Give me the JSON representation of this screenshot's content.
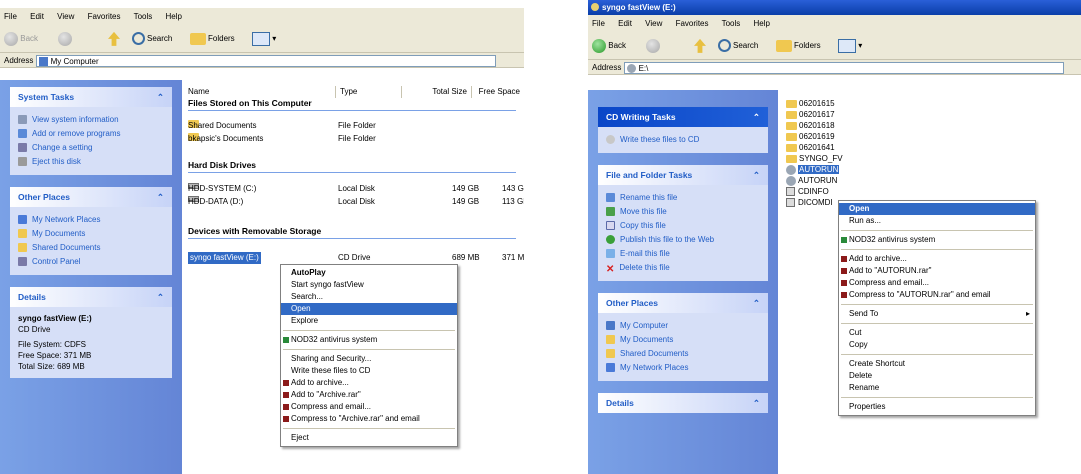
{
  "left": {
    "menu": [
      "File",
      "Edit",
      "View",
      "Favorites",
      "Tools",
      "Help"
    ],
    "toolbar": {
      "back": "Back",
      "search": "Search",
      "folders": "Folders"
    },
    "address": {
      "label": "Address",
      "value": "My Computer"
    },
    "system_tasks": {
      "title": "System Tasks",
      "items": [
        "View system information",
        "Add or remove programs",
        "Change a setting",
        "Eject this disk"
      ]
    },
    "other_places": {
      "title": "Other Places",
      "items": [
        "My Network Places",
        "My Documents",
        "Shared Documents",
        "Control Panel"
      ]
    },
    "details": {
      "title": "Details",
      "name": "syngo fastView (E:)",
      "type": "CD Drive",
      "fs": "File System: CDFS",
      "free": "Free Space: 371 MB",
      "total": "Total Size: 689 MB"
    },
    "columns": [
      "Name",
      "Type",
      "Total Size",
      "Free Space"
    ],
    "groups": [
      "Files Stored on This Computer",
      "Hard Disk Drives",
      "Devices with Removable Storage"
    ],
    "files": [
      {
        "name": "Shared Documents",
        "type": "File Folder"
      },
      {
        "name": "bkapsic's Documents",
        "type": "File Folder"
      }
    ],
    "drives": [
      {
        "name": "HDD-SYSTEM (C:)",
        "type": "Local Disk",
        "total": "149 GB",
        "free": "143 GB"
      },
      {
        "name": "HDD-DATA (D:)",
        "type": "Local Disk",
        "total": "149 GB",
        "free": "113 GB"
      }
    ],
    "removable": {
      "name": "syngo fastView (E:)",
      "type": "CD Drive",
      "total": "689 MB",
      "free": "371 MB"
    },
    "context_menu": [
      "AutoPlay",
      "Start syngo fastView",
      "Search...",
      "Open",
      "Explore",
      "NOD32 antivirus system",
      "Sharing and Security...",
      "Write these files to CD",
      "Add to archive...",
      "Add to \"Archive.rar\"",
      "Compress and email...",
      "Compress to \"Archive.rar\" and email",
      "Eject"
    ]
  },
  "right": {
    "title": "syngo fastView (E:)",
    "menu": [
      "File",
      "Edit",
      "View",
      "Favorites",
      "Tools",
      "Help"
    ],
    "toolbar": {
      "back": "Back",
      "search": "Search",
      "folders": "Folders"
    },
    "address": {
      "label": "Address",
      "value": "E:\\"
    },
    "cd_tasks": {
      "title": "CD Writing Tasks",
      "items": [
        "Write these files to CD"
      ]
    },
    "file_tasks": {
      "title": "File and Folder Tasks",
      "items": [
        "Rename this file",
        "Move this file",
        "Copy this file",
        "Publish this file to the Web",
        "E-mail this file",
        "Delete this file"
      ]
    },
    "other_places": {
      "title": "Other Places",
      "items": [
        "My Computer",
        "My Documents",
        "Shared Documents",
        "My Network Places"
      ]
    },
    "details_title": "Details",
    "files": [
      "06201615",
      "06201617",
      "06201618",
      "06201619",
      "06201641",
      "SYNGO_FV",
      "AUTORUN",
      "AUTORUN",
      "CDINFO",
      "DICOMDI"
    ],
    "context_menu": [
      "Open",
      "Run as...",
      "NOD32 antivirus system",
      "Add to archive...",
      "Add to \"AUTORUN.rar\"",
      "Compress and email...",
      "Compress to \"AUTORUN.rar\" and email",
      "Send To",
      "Cut",
      "Copy",
      "Create Shortcut",
      "Delete",
      "Rename",
      "Properties"
    ]
  },
  "colors": {
    "task_pane": "#6f95e0",
    "highlight": "#316ac5",
    "titlebar": "#0a3ea8"
  }
}
